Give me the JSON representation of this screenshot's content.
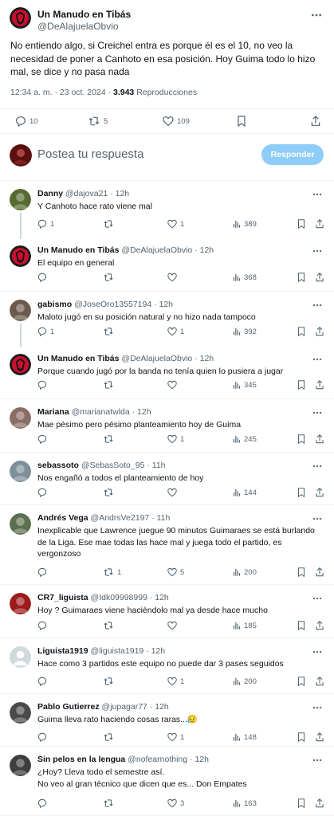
{
  "main_tweet": {
    "display_name": "Un Manudo en Tibás",
    "handle": "@DeAlajuelaObvio",
    "text": "No entiendo algo, si Creichel entra es porque él es el 10, no veo la necesidad de poner a Canhoto en esa posición. Hoy Guima todo lo hizo mal, se dice y no pasa nada",
    "timestamp": "12:34 a. m. · 23 oct. 2024 · ",
    "views_count": "3.943",
    "views_label": " Reproducciones",
    "replies": "10",
    "reposts": "5",
    "likes": "109",
    "avatar_color": "#c8102e"
  },
  "reply_box": {
    "placeholder": "Postea tu respuesta",
    "button_label": "Responder",
    "button_color": "#8ecdf8"
  },
  "replies": [
    {
      "name": "Danny",
      "handle": "@dajova21",
      "time": "· 12h",
      "text": "Y Canhoto hace rato viene mal",
      "replies": "1",
      "reposts": "",
      "likes": "1",
      "views": "389",
      "avatar": "profile-photo",
      "avatar_color": "#556b2f"
    },
    {
      "name": "Un Manudo en Tibás",
      "handle": "@DeAlajuelaObvio",
      "time": "· 12h",
      "text": "El equipo en general",
      "replies": "",
      "reposts": "",
      "likes": "",
      "views": "368",
      "avatar": "red-crest",
      "avatar_color": "#c8102e"
    },
    {
      "name": "gabismo",
      "handle": "@JoseOro13557194",
      "time": "· 12h",
      "text": "Maloto jugó en su posición natural y no hizo nada tampoco",
      "replies": "1",
      "reposts": "",
      "likes": "1",
      "views": "392",
      "avatar": "profile-photo",
      "avatar_color": "#6b5a4b"
    },
    {
      "name": "Un Manudo en Tibás",
      "handle": "@DeAlajuelaObvio",
      "time": "· 12h",
      "text": "Porque cuando jugó por la banda no tenía quien lo pusiera a jugar",
      "replies": "",
      "reposts": "",
      "likes": "",
      "views": "345",
      "avatar": "red-crest",
      "avatar_color": "#c8102e"
    },
    {
      "name": "Mariana",
      "handle": "@marianatwlda",
      "time": "· 12h",
      "text": "Mae pésimo pero pésimo planteamiento hoy de Guima",
      "replies": "",
      "reposts": "",
      "likes": "1",
      "views": "245",
      "avatar": "profile-photo",
      "avatar_color": "#8a6e64"
    },
    {
      "name": "sebassoto",
      "handle": "@SebasSoto_95",
      "time": "· 11h",
      "text": "Nos engañó a todos el planteamiento de hoy",
      "replies": "",
      "reposts": "",
      "likes": "",
      "views": "144",
      "avatar": "profile-photo",
      "avatar_color": "#7d8f99"
    },
    {
      "name": "Andrés Vega",
      "handle": "@AndrsVe2197",
      "time": "· 11h",
      "text": "Inexplicable que Lawrence juegue 90 minutos Guimaraes se está burlando de la Liga. Ese mae todas las hace mal y juega todo el partido, es vergonzoso",
      "replies": "",
      "reposts": "1",
      "likes": "5",
      "views": "200",
      "avatar": "profile-photo",
      "avatar_color": "#5c6f4e"
    },
    {
      "name": "CR7_liguista",
      "handle": "@Idk09998999",
      "time": "· 12h",
      "text": "Hoy ? Guimaraes viene haciéndolo mal ya desde hace mucho",
      "replies": "",
      "reposts": "",
      "likes": "",
      "views": "185",
      "avatar": "profile-photo",
      "avatar_color": "#9e1b1b"
    },
    {
      "name": "Liguista1919",
      "handle": "@liguista1919",
      "time": "· 12h",
      "text": "Hace como 3 partidos este equipo no puede dar 3 pases seguidos",
      "replies": "",
      "reposts": "",
      "likes": "1",
      "views": "200",
      "avatar": "default-avatar",
      "avatar_color": "#cfd9de"
    },
    {
      "name": "Pablo Gutierrez",
      "handle": "@jupagar77",
      "time": "· 12h",
      "text": "Guima lleva rato haciendo cosas raras...😥",
      "replies": "",
      "reposts": "",
      "likes": "1",
      "views": "148",
      "avatar": "profile-photo",
      "avatar_color": "#4a4a4a"
    },
    {
      "name": "Sin pelos en la lengua",
      "handle": "@nofearnothing",
      "time": "· 12h",
      "text": "¿Hoy? Lleva todo el semestre así.\nNo veo al gran técnico que dicen que es... Don Empates",
      "replies": "",
      "reposts": "",
      "likes": "3",
      "views": "163",
      "avatar": "profile-photo",
      "avatar_color": "#3e3e3e"
    }
  ]
}
